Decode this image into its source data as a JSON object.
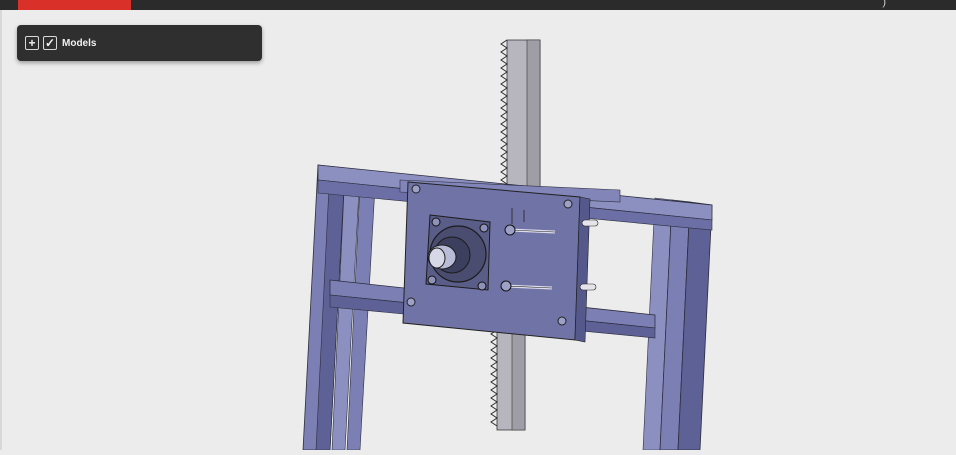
{
  "models_panel": {
    "expand_glyph": "+",
    "checkbox_glyph": "✓",
    "label": "Models"
  },
  "colors": {
    "brand": "#d9302a",
    "topbar": "#2b2b2b",
    "viewport_bg": "#ececec",
    "panel_bg": "#2f2f2f",
    "frame_steel": "#7b7fb3",
    "frame_shadow": "#5d6196",
    "plate": "#7073a6",
    "rack": "#b7b6be"
  },
  "icons": [
    "plus-icon",
    "check-icon"
  ]
}
